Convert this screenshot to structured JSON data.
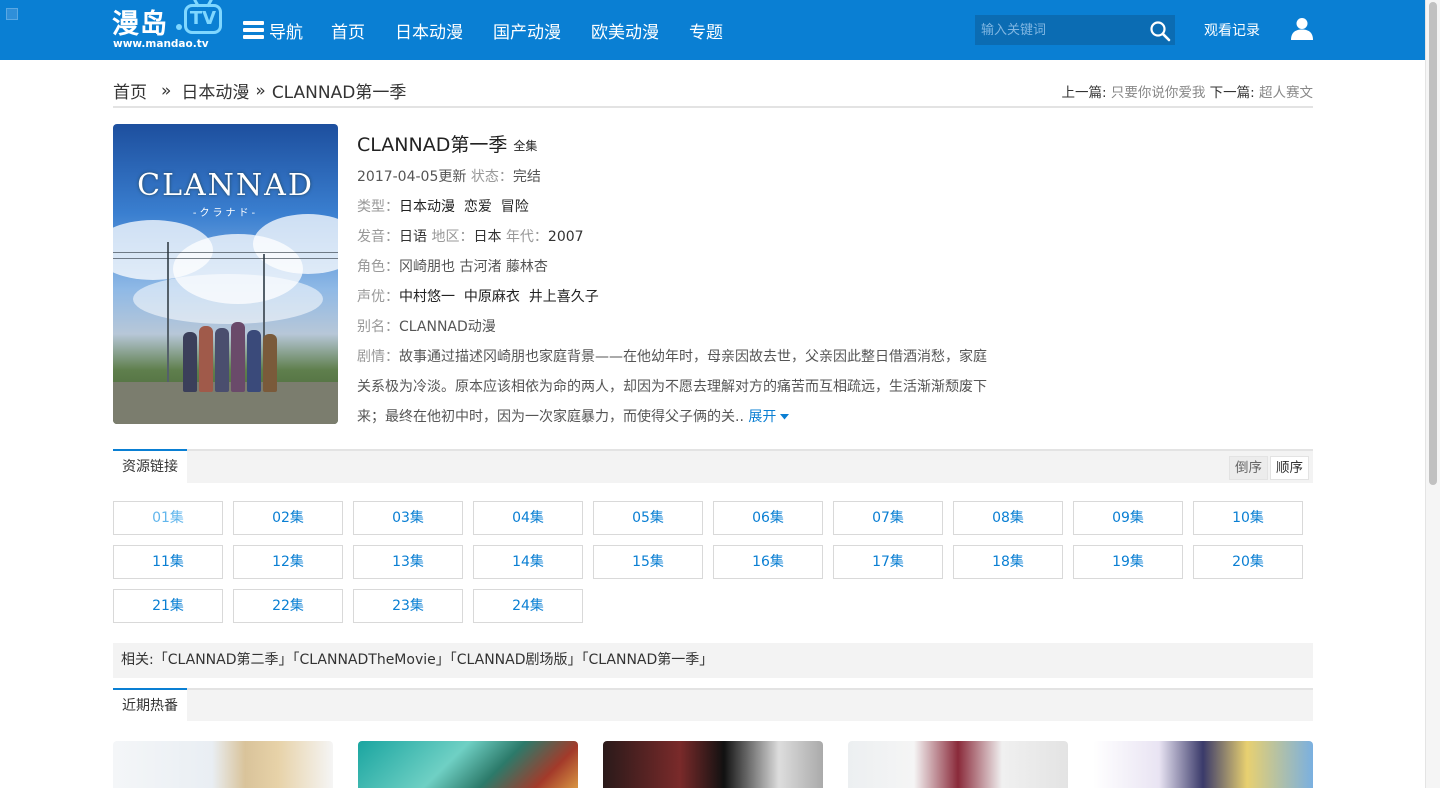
{
  "header": {
    "logo_main": "漫岛",
    "logo_tv": "TV",
    "logo_sub": "www.mandao.tv",
    "nav_menu_label": "导航",
    "nav_links": [
      "首页",
      "日本动漫",
      "国产动漫",
      "欧美动漫",
      "专题"
    ],
    "search_placeholder": "输入关键词",
    "history_label": "观看记录"
  },
  "breadcrumb": {
    "home": "首页",
    "sep1": "»",
    "category": "日本动漫",
    "sep2": "»",
    "current": "CLANNAD第一季"
  },
  "prevnext": {
    "prev_label": "上一篇:",
    "prev_title": "只要你说你爱我",
    "next_label": "下一篇:",
    "next_title": "超人赛文"
  },
  "poster": {
    "title": "CLANNAD",
    "subtitle": "-クラナド-"
  },
  "info": {
    "title": "CLANNAD第一季",
    "badge": "全集",
    "update": "2017-04-05更新",
    "status_label": "状态：",
    "status": "完结",
    "type_label": "类型：",
    "types": "日本动漫  恋爱  冒险",
    "lang_label": "发音：",
    "lang": "日语",
    "region_label": "地区：",
    "region": "日本",
    "year_label": "年代：",
    "year": "2007",
    "roles_label": "角色：",
    "roles": "冈崎朋也 古河渚 藤林杏",
    "cv_label": "声优：",
    "cv": "中村悠一  中原麻衣  井上喜久子",
    "alias_label": "别名：",
    "alias": "CLANNAD动漫",
    "plot_label": "剧情：",
    "plot": "故事通过描述冈崎朋也家庭背景——在他幼年时，母亲因故去世，父亲因此整日借酒消愁，家庭关系极为冷淡。原本应该相依为命的两人，却因为不愿去理解对方的痛苦而互相疏远，生活渐渐颓废下来；最终在他初中时，因为一次家庭暴力，而使得父子俩的关..",
    "expand": "展开"
  },
  "resources": {
    "tab": "资源链接",
    "desc": "倒序",
    "asc": "顺序",
    "episodes": [
      "01集",
      "02集",
      "03集",
      "04集",
      "05集",
      "06集",
      "07集",
      "08集",
      "09集",
      "10集",
      "11集",
      "12集",
      "13集",
      "14集",
      "15集",
      "16集",
      "17集",
      "18集",
      "19集",
      "20集",
      "21集",
      "22集",
      "23集",
      "24集"
    ]
  },
  "related": "相关:「CLANNAD第二季」「CLANNADTheMovie」「CLANNAD剧场版」「CLANNAD第一季」",
  "recent": {
    "tab": "近期热番"
  },
  "colors": {
    "brand_blue": "#0a7fd3",
    "visited_blue": "#62b6ec"
  }
}
